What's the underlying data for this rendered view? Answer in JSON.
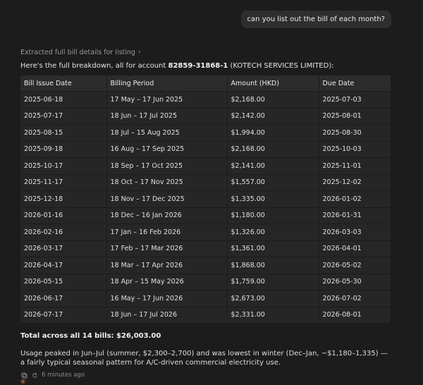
{
  "user_message": "can you list out the bill of each month?",
  "thinking_label": "Extracted full bill details for listing",
  "intro": {
    "prefix": "Here's the full breakdown, all for account ",
    "account": "82859-31868-1",
    "suffix": " (KOTECH SERVICES LIMITED):"
  },
  "table": {
    "headers": [
      "Bill Issue Date",
      "Billing Period",
      "Amount (HKD)",
      "Due Date"
    ],
    "rows": [
      [
        "2025-06-18",
        "17 May – 17 Jun 2025",
        "$2,168.00",
        "2025-07-03"
      ],
      [
        "2025-07-17",
        "18 Jun – 17 Jul 2025",
        "$2,142.00",
        "2025-08-01"
      ],
      [
        "2025-08-15",
        "18 Jul – 15 Aug 2025",
        "$1,994.00",
        "2025-08-30"
      ],
      [
        "2025-09-18",
        "16 Aug – 17 Sep 2025",
        "$2,168.00",
        "2025-10-03"
      ],
      [
        "2025-10-17",
        "18 Sep – 17 Oct 2025",
        "$2,141.00",
        "2025-11-01"
      ],
      [
        "2025-11-17",
        "18 Oct – 17 Nov 2025",
        "$1,557.00",
        "2025-12-02"
      ],
      [
        "2025-12-18",
        "18 Nov – 17 Dec 2025",
        "$1,335.00",
        "2026-01-02"
      ],
      [
        "2026-01-16",
        "18 Dec – 16 Jan 2026",
        "$1,180.00",
        "2026-01-31"
      ],
      [
        "2026-02-16",
        "17 Jan – 16 Feb 2026",
        "$1,326.00",
        "2026-03-03"
      ],
      [
        "2026-03-17",
        "17 Feb – 17 Mar 2026",
        "$1,361.00",
        "2026-04-01"
      ],
      [
        "2026-04-17",
        "18 Mar – 17 Apr 2026",
        "$1,868.00",
        "2026-05-02"
      ],
      [
        "2026-05-15",
        "18 Apr – 15 May 2026",
        "$1,759.00",
        "2026-05-30"
      ],
      [
        "2026-06-17",
        "16 May – 17 Jun 2026",
        "$2,673.00",
        "2026-07-02"
      ],
      [
        "2026-07-17",
        "18 Jun – 17 Jul 2026",
        "$2,331.00",
        "2026-08-01"
      ]
    ]
  },
  "total": "Total across all 14 bills: $26,003.00",
  "summary": "Usage peaked in Jun–Jul (summer, $2,300–2,700) and was lowest in winter (Dec–Jan, ~$1,180–1,335) — a fairly typical seasonal pattern for A/C-driven commercial electricity use.",
  "meta": {
    "timestamp": "6 minutes ago",
    "icons": [
      "copy-icon",
      "retry-icon"
    ]
  },
  "colors": {
    "background": "#1c1c1c",
    "bubble": "#2e2e2e",
    "table_header": "#2c2c2c",
    "table_cell": "#262626",
    "accent": "#d9774b"
  }
}
